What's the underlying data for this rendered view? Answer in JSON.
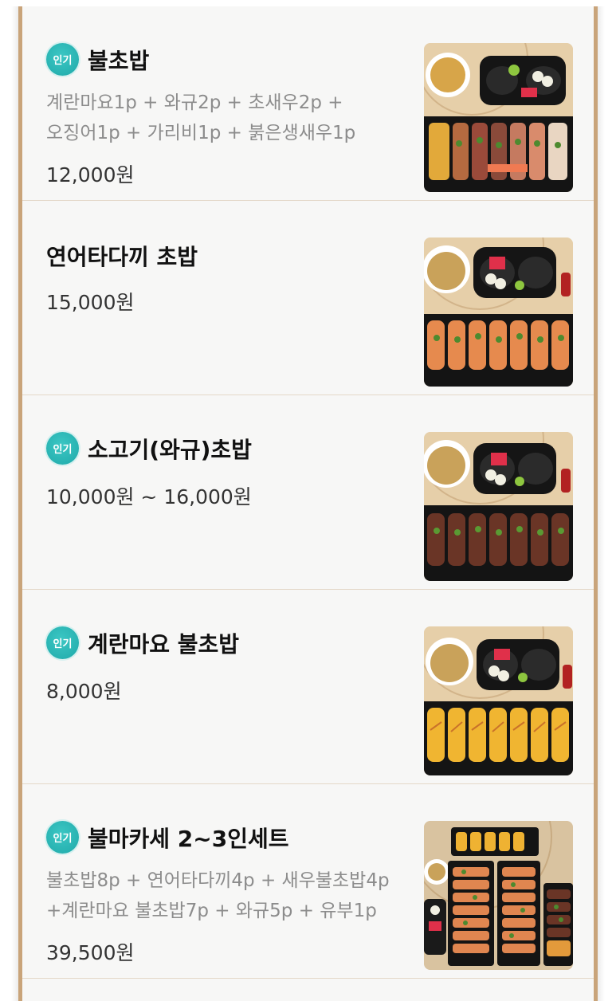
{
  "badge_label": "인기",
  "items": [
    {
      "name": "불초밥",
      "popular": true,
      "description": [
        "계란마요1p + 와규2p + 초새우2p +",
        "오징어1p + 가리비1p + 붉은생새우1p"
      ],
      "price": "12,000원",
      "image": "fire-sushi-set-photo"
    },
    {
      "name": "연어타다끼 초밥",
      "popular": false,
      "description": [],
      "price": "15,000원",
      "image": "salmon-tataki-sushi-photo"
    },
    {
      "name": "소고기(와규)초밥",
      "popular": true,
      "description": [],
      "price": "10,000원 ~ 16,000원",
      "image": "wagyu-sushi-photo"
    },
    {
      "name": "계란마요 불초밥",
      "popular": true,
      "description": [],
      "price": "8,000원",
      "image": "egg-mayo-fire-sushi-photo"
    },
    {
      "name": "불마카세 2~3인세트",
      "popular": true,
      "description": [
        "불초밥8p + 연어타다끼4p + 새우불초밥4p",
        "+계란마요 불초밥7p + 와규5p + 유부1p"
      ],
      "price": "39,500원",
      "image": "bulmakase-set-photo"
    }
  ],
  "colors": {
    "badge": "#22b0ae",
    "panel_border": "#c9a47a",
    "description": "#8c8c8c"
  }
}
